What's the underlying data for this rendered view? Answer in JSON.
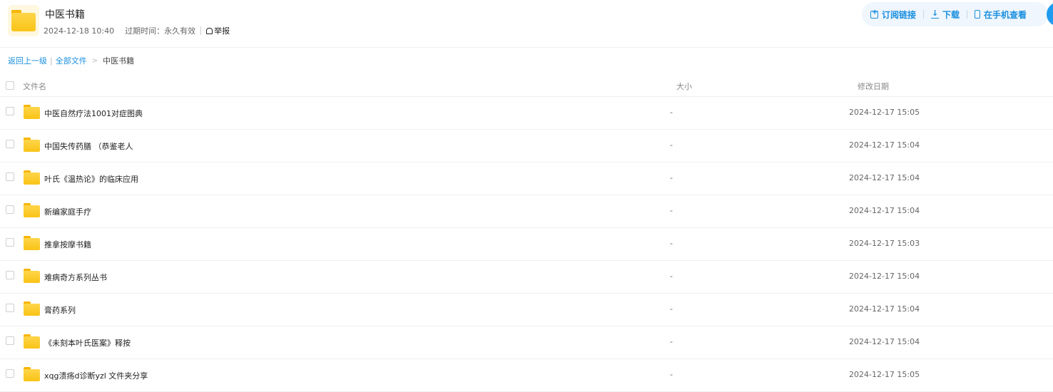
{
  "header": {
    "title": "中医书籍",
    "date": "2024-12-18 10:40",
    "expire_label": "过期时间：",
    "expire_value": "永久有效",
    "report_label": "举报",
    "actions": {
      "subscribe_label": "订阅链接",
      "download_label": "下载",
      "mobile_label": "在手机查看"
    }
  },
  "breadcrumb": {
    "back_label": "返回上一级",
    "all_files_label": "全部文件",
    "current_label": "中医书籍"
  },
  "table": {
    "columns": {
      "name": "文件名",
      "size": "大小",
      "date": "修改日期"
    },
    "rows": [
      {
        "name": "中医自然疗法1001对症图典",
        "size": "-",
        "date": "2024-12-17 15:05"
      },
      {
        "name": "中国失传药膳 （恭鉴老人",
        "size": "-",
        "date": "2024-12-17 15:04"
      },
      {
        "name": "叶氏《温热论》的临床应用",
        "size": "-",
        "date": "2024-12-17 15:04"
      },
      {
        "name": "新编家庭手疗",
        "size": "-",
        "date": "2024-12-17 15:04"
      },
      {
        "name": "推拿按摩书籍",
        "size": "-",
        "date": "2024-12-17 15:03"
      },
      {
        "name": "难病奇方系列丛书",
        "size": "-",
        "date": "2024-12-17 15:04"
      },
      {
        "name": "膏药系列",
        "size": "-",
        "date": "2024-12-17 15:04"
      },
      {
        "name": "《未刻本叶氏医案》释按",
        "size": "-",
        "date": "2024-12-17 15:04"
      },
      {
        "name": "xqg溃疡d诊断yzl 文件夹分享",
        "size": "-",
        "date": "2024-12-17 15:05"
      }
    ]
  },
  "colors": {
    "accent": "#1a8fdf",
    "folder": "#f9c416",
    "actions_bg": "#f0f6fd"
  }
}
